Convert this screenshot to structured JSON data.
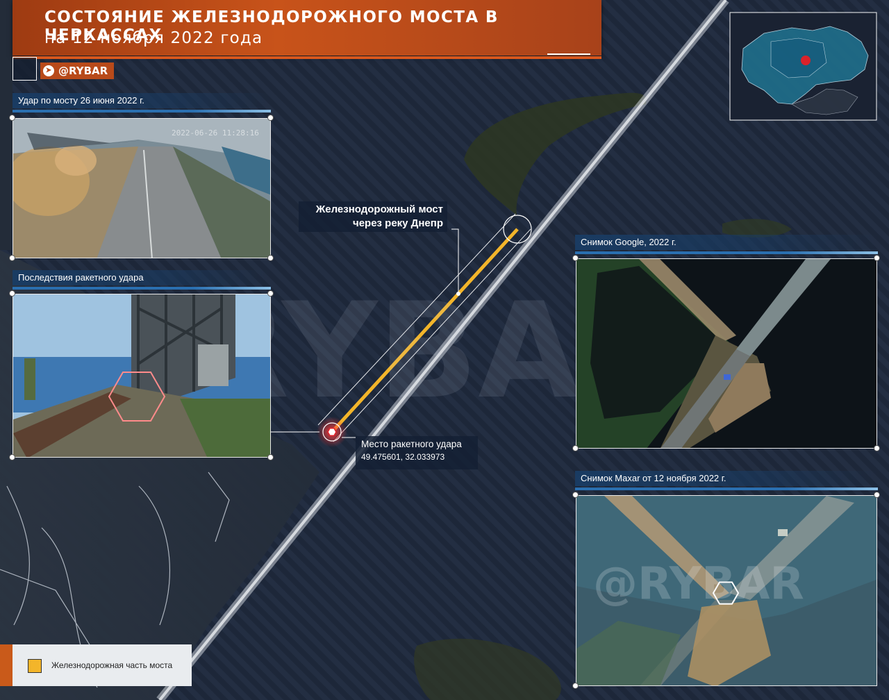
{
  "title": {
    "line1": "СОСТОЯНИЕ ЖЕЛЕЗНОДОРОЖНОГО МОСТА В ЧЕРКАССАХ",
    "line2": "на 12 ноября 2022 года"
  },
  "brand": {
    "handle": "@RYBAR",
    "watermark": "@RYBAR",
    "telegram_icon": "telegram-icon"
  },
  "panels": {
    "strike_video": {
      "caption": "Удар по мосту 26 июня 2022 г.",
      "timestamp": "2022-06-26 11:28:16"
    },
    "aftermath": {
      "caption": "Последствия ракетного удара"
    },
    "google": {
      "caption": "Снимок Google, 2022 г."
    },
    "maxar": {
      "caption": "Снимок Maxar от 12 ноября 2022 г."
    }
  },
  "labels": {
    "bridge": "Железнодорожный мост\nчерез реку Днепр",
    "strike_place": "Место ракетного удара",
    "strike_coords": "49.475601, 32.033973"
  },
  "legend": {
    "items": [
      {
        "label": "Железнодорожная часть моста",
        "color": "#f3b52a"
      }
    ]
  },
  "colors": {
    "accent": "#c8531a",
    "water": "#1c2638",
    "rail_section": "#f3b52a",
    "strike": "#e0222a"
  }
}
